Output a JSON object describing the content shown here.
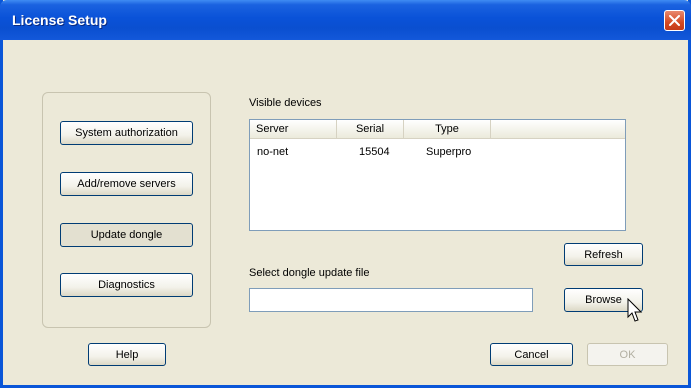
{
  "window": {
    "title": "License Setup"
  },
  "left_panel": {
    "buttons": [
      {
        "label": "System authorization"
      },
      {
        "label": "Add/remove servers"
      },
      {
        "label": "Update dongle"
      },
      {
        "label": "Diagnostics"
      }
    ]
  },
  "devices": {
    "label": "Visible devices",
    "columns": [
      "Server",
      "Serial",
      "Type"
    ],
    "rows": [
      {
        "server": "no-net",
        "serial": "15504",
        "type": "Superpro"
      }
    ]
  },
  "refresh_label": "Refresh",
  "update_file": {
    "label": "Select dongle update file",
    "value": "",
    "browse_label": "Browse"
  },
  "footer": {
    "help_label": "Help",
    "cancel_label": "Cancel",
    "ok_label": "OK"
  },
  "icons": {
    "close": "close-icon",
    "cursor": "mouse-cursor-icon"
  },
  "colors": {
    "titlebar": "#0a52d8",
    "dialog_bg": "#ece9d8",
    "close": "#d44a23"
  }
}
